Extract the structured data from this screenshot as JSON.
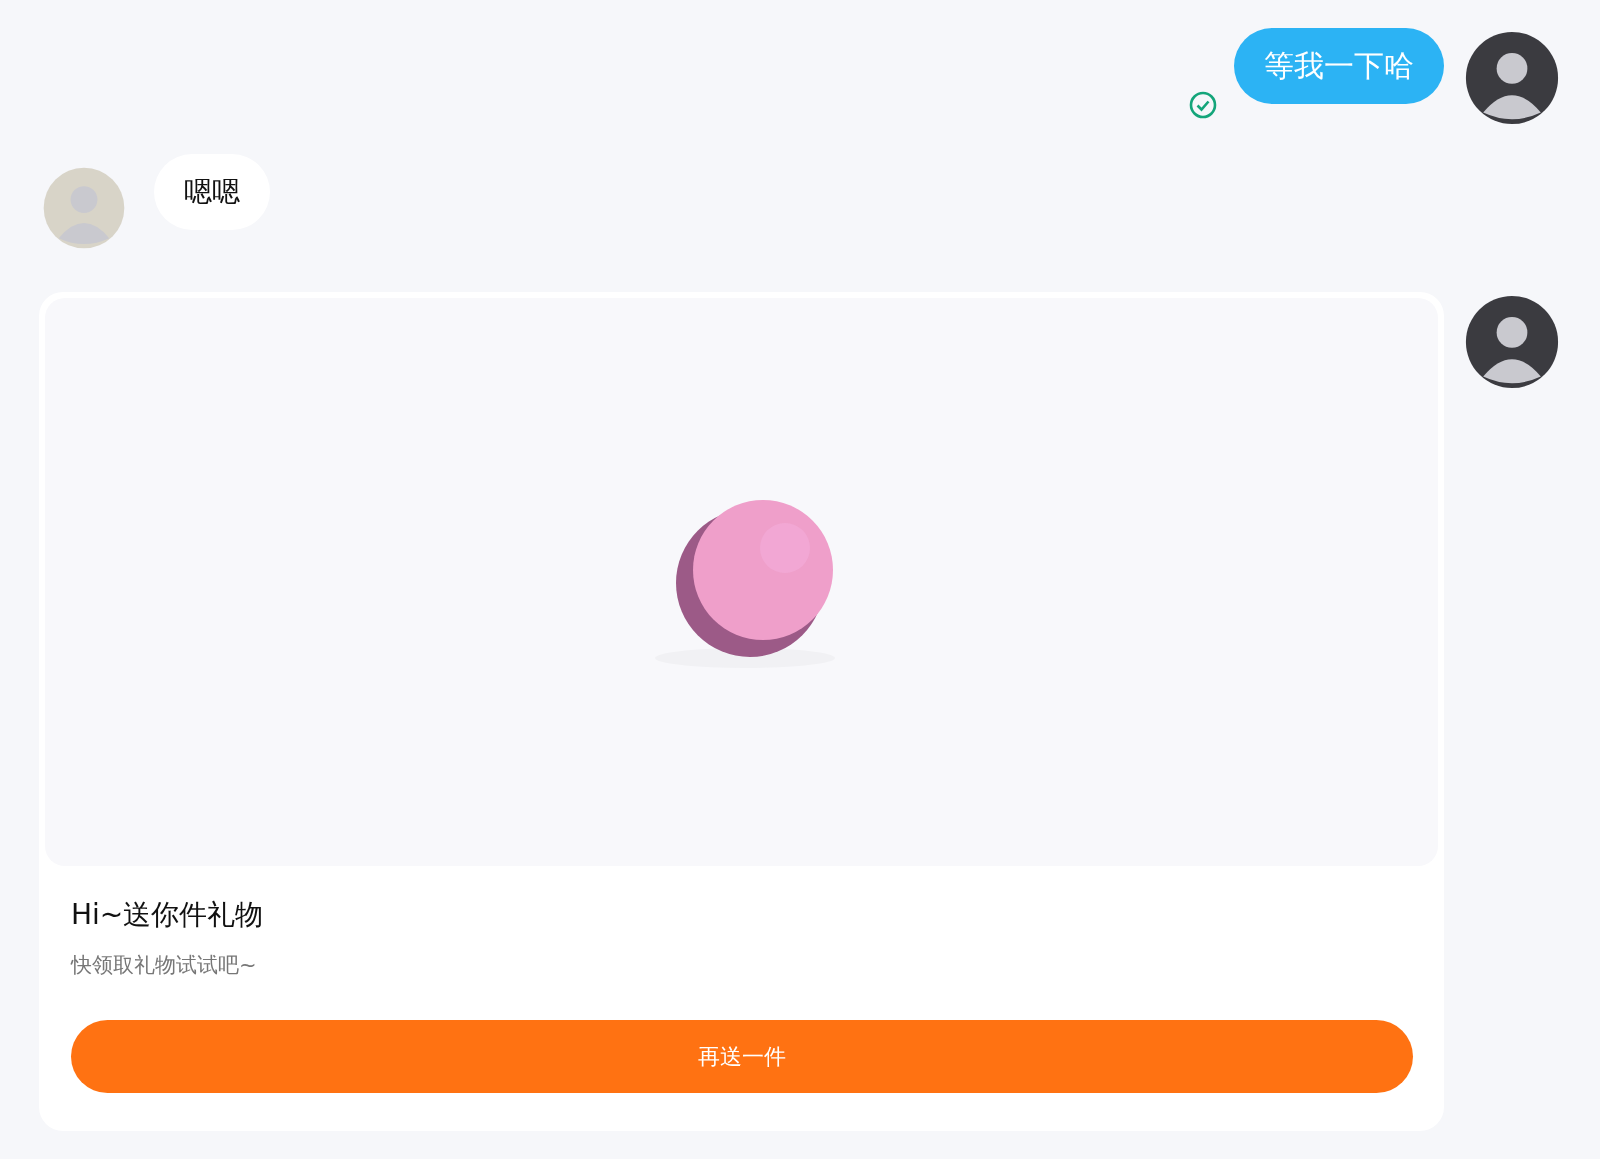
{
  "messages": [
    {
      "kind": "text",
      "outgoing": true,
      "text": "等我一下哈",
      "delivered": true
    },
    {
      "kind": "text",
      "outgoing": false,
      "text": "嗯嗯"
    },
    {
      "kind": "gift",
      "outgoing": true,
      "gift": {
        "kind": "picture",
        "title": "Hi~送你件礼物",
        "subtitle": "快领取礼物试试吧~",
        "button": "再送一件"
      }
    }
  ]
}
